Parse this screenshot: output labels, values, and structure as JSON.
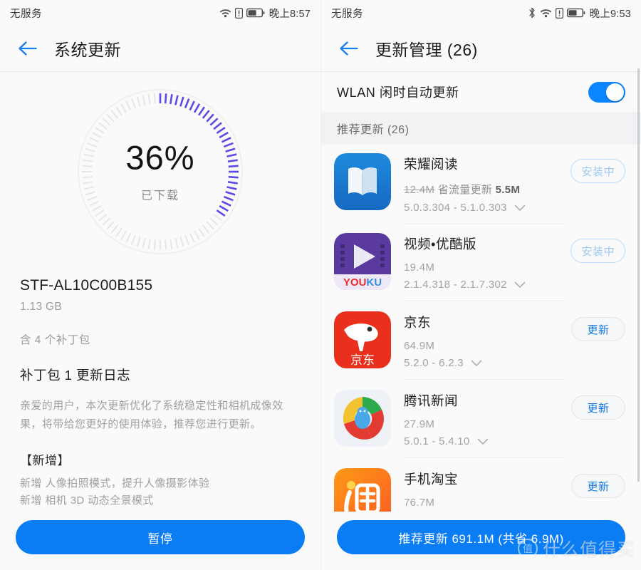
{
  "left": {
    "statusbar": {
      "carrier": "无服务",
      "time": "晚上8:57",
      "icons": [
        "wifi-icon",
        "sim-alert-icon",
        "battery-icon"
      ]
    },
    "appbar": {
      "back": "back-arrow-icon",
      "title": "系统更新"
    },
    "progress": {
      "percent_text": "36%",
      "percent_value": 36,
      "label": "已下载",
      "arc_color": "#5b4ae8",
      "track_color": "#e6e6e6"
    },
    "details": {
      "build_name": "STF-AL10C00B155",
      "build_size": "1.13 GB",
      "patch_count": "含 4 个补丁包",
      "patch_title": "补丁包 1 更新日志",
      "patch_body": "亲爱的用户，本次更新优化了系统稳定性和相机成像效果，将带给您更好的使用体验，推荐您进行更新。",
      "section_heading": "【新增】",
      "bullets": [
        "新增 人像拍照模式，提升人像摄影体验",
        "新增 相机 3D 动态全景模式"
      ]
    },
    "cta": {
      "label": "暂停",
      "color": "#0a7df5"
    }
  },
  "right": {
    "statusbar": {
      "carrier": "无服务",
      "time": "晚上9:53",
      "icons": [
        "bluetooth-icon",
        "wifi-icon",
        "sim-alert-icon",
        "battery-icon"
      ]
    },
    "appbar": {
      "back": "back-arrow-icon",
      "title": "更新管理 (26)"
    },
    "auto_update": {
      "label": "WLAN 闲时自动更新",
      "enabled": true
    },
    "group_header": "推荐更新 (26)",
    "apps": [
      {
        "name": "荣耀阅读",
        "icon": "honor-reader-icon",
        "size_struck": "12.4M",
        "saver_label": "省流量更新",
        "saver_size": "5.5M",
        "size": "",
        "versions": "5.0.3.304 - 5.1.0.303",
        "action": "安装中",
        "action_style": "outline"
      },
      {
        "name": "视频•优酷版",
        "icon": "youku-icon",
        "size_struck": "",
        "saver_label": "",
        "saver_size": "",
        "size": "19.4M",
        "versions": "2.1.4.318 - 2.1.7.302",
        "action": "安装中",
        "action_style": "outline"
      },
      {
        "name": "京东",
        "icon": "jd-icon",
        "size_struck": "",
        "saver_label": "",
        "saver_size": "",
        "size": "64.9M",
        "versions": "5.2.0 - 6.2.3",
        "action": "更新",
        "action_style": "update"
      },
      {
        "name": "腾讯新闻",
        "icon": "tencent-news-icon",
        "size_struck": "",
        "saver_label": "",
        "saver_size": "",
        "size": "27.9M",
        "versions": "5.0.1 - 5.4.10",
        "action": "更新",
        "action_style": "update"
      },
      {
        "name": "手机淘宝",
        "icon": "taobao-icon",
        "size_struck": "",
        "saver_label": "",
        "saver_size": "",
        "size": "76.7M",
        "versions": "",
        "action": "更新",
        "action_style": "update"
      }
    ],
    "cta": {
      "label": "推荐更新 691.1M (共省 6.9M)",
      "color": "#0a7df5"
    }
  },
  "watermark": {
    "badge": "值",
    "text": "什么值得买"
  }
}
